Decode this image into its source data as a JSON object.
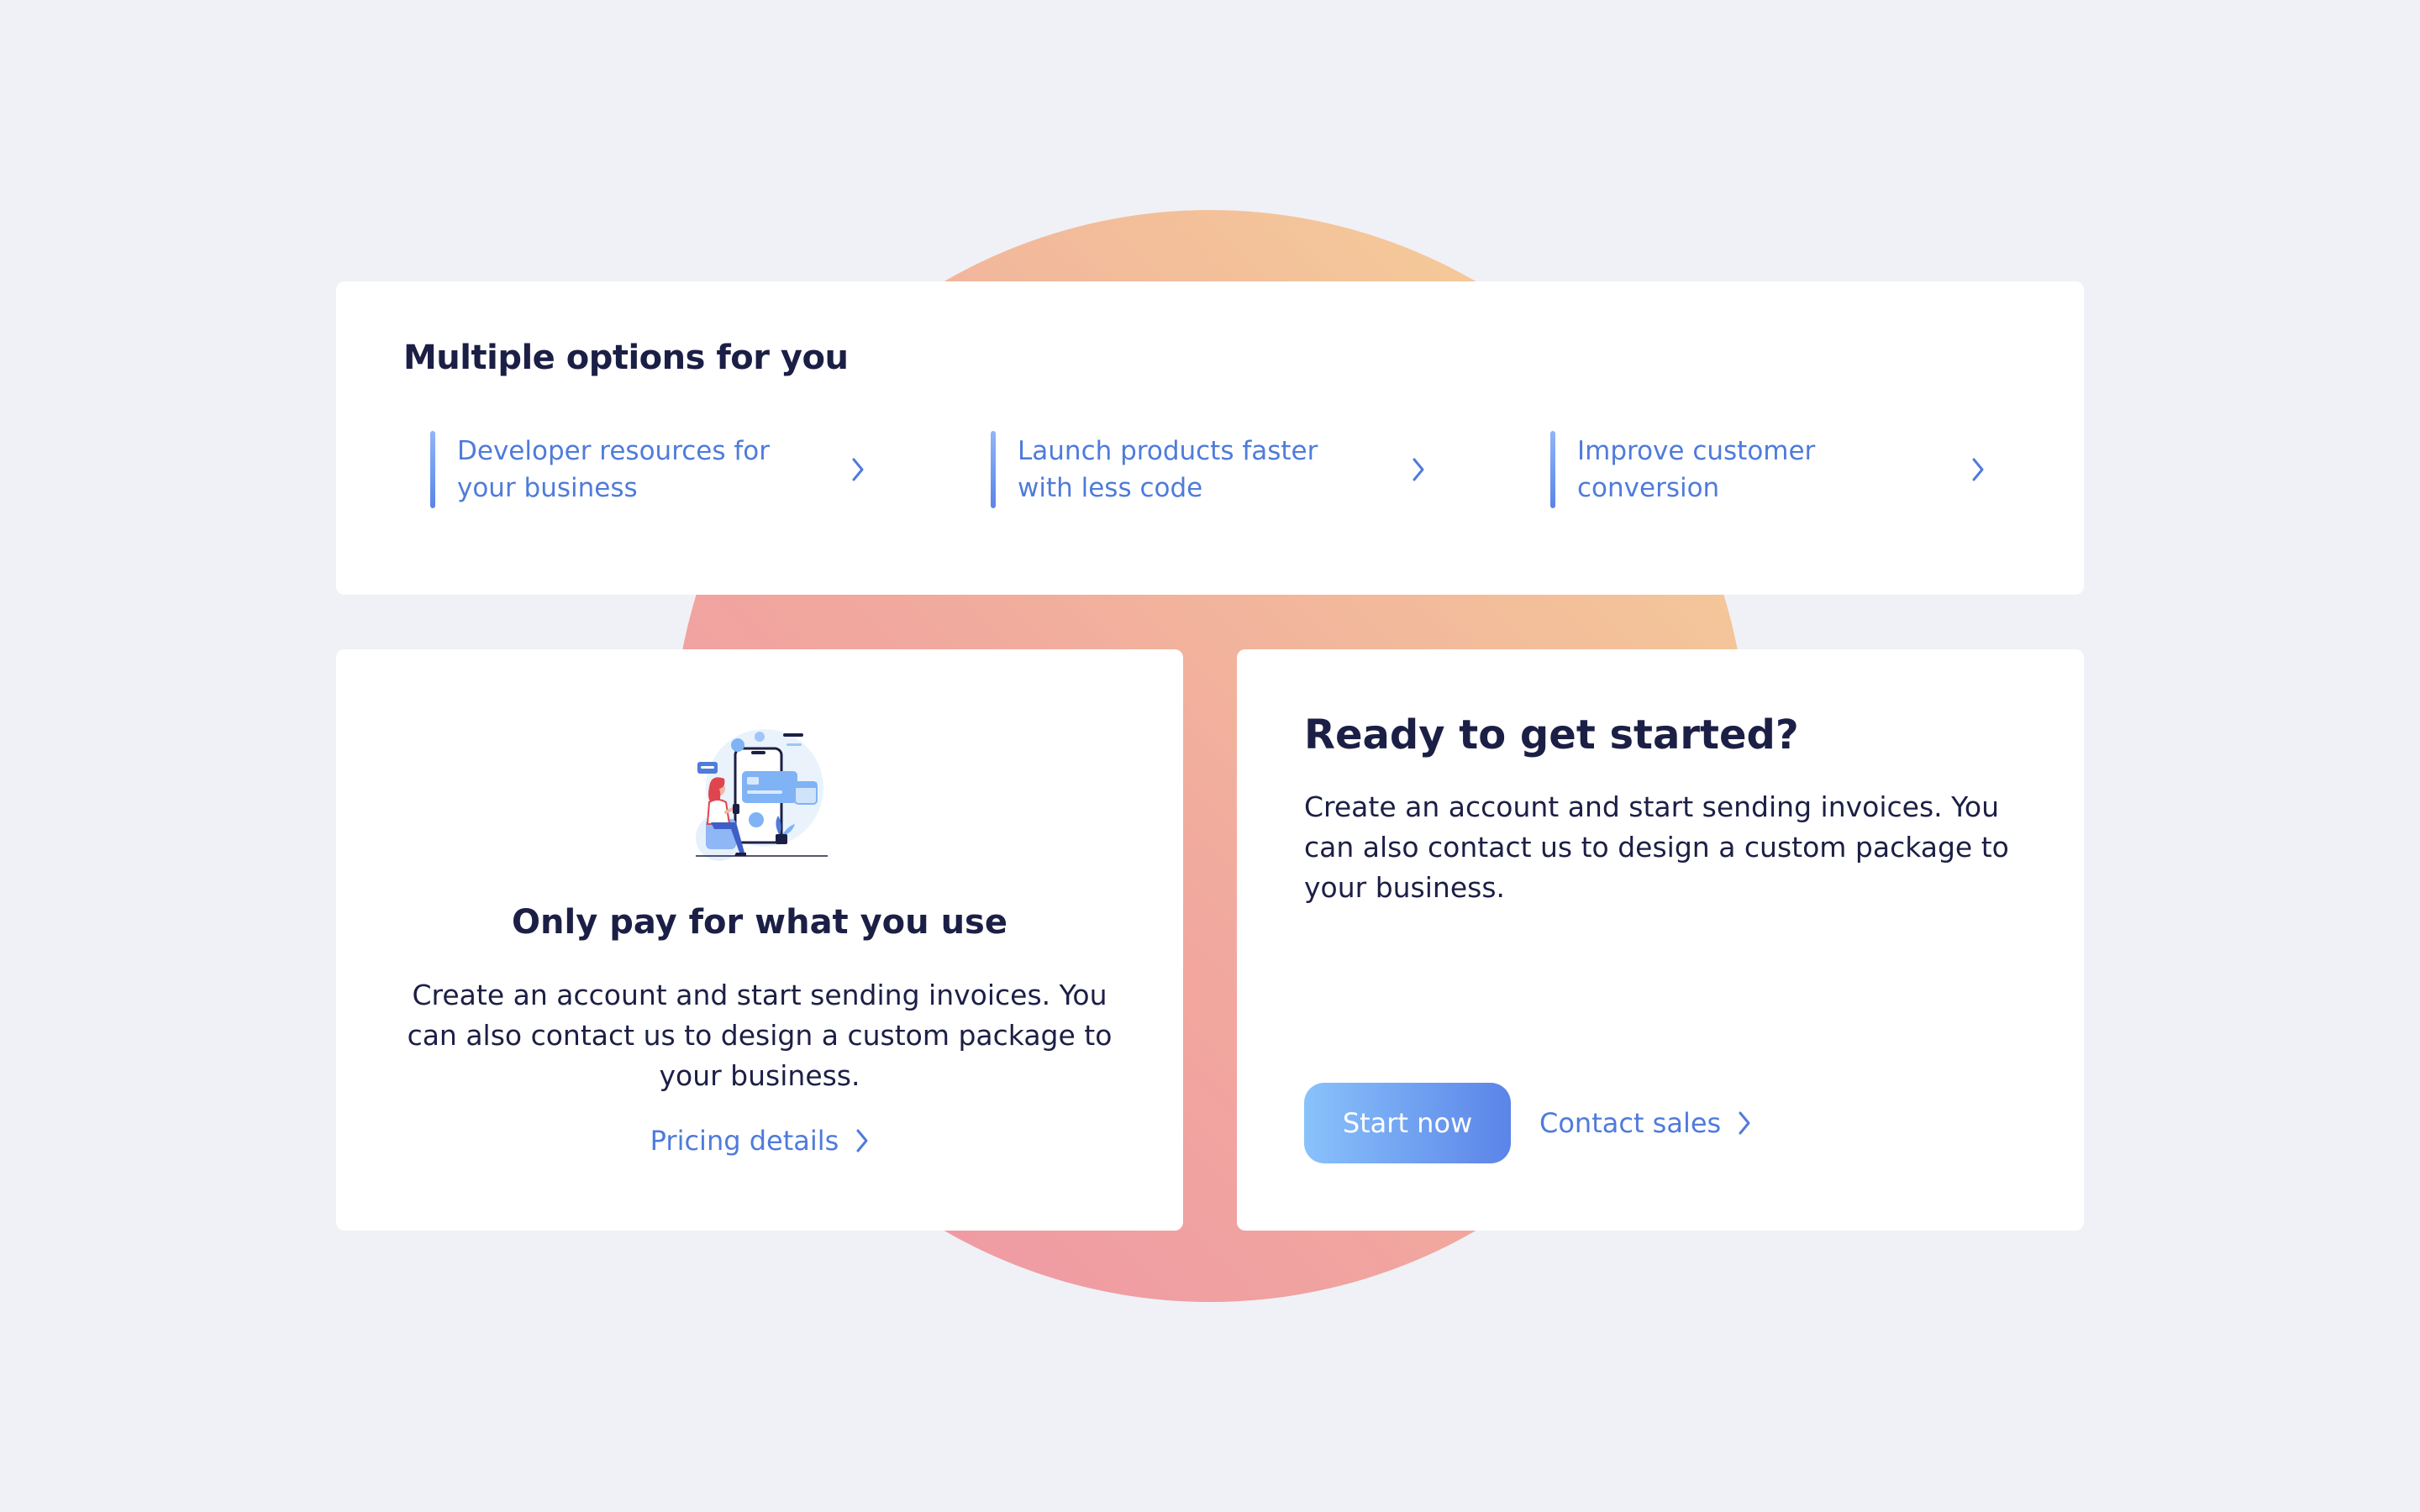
{
  "options_card": {
    "title": "Multiple options for you",
    "items": [
      {
        "label": "Developer resources for your business"
      },
      {
        "label": "Launch products faster with less code"
      },
      {
        "label": "Improve customer conversion"
      }
    ]
  },
  "pricing_card": {
    "title": "Only pay for what you use",
    "description": "Create an account and start sending invoices. You can also contact us to design a custom package to your business.",
    "link_label": "Pricing details"
  },
  "start_card": {
    "title": "Ready to get started?",
    "description": "Create an account and start sending invoices. You can also contact us to design a custom package to your business.",
    "primary_button": "Start now",
    "secondary_link": "Contact sales"
  },
  "colors": {
    "page_background": "#f0f1f6",
    "card_background": "#ffffff",
    "heading": "#1c1f45",
    "link": "#4f7bdb",
    "button_gradient_start": "#89c2fb",
    "button_gradient_end": "#5b84e8",
    "blob_gradient_start": "#ef93a7",
    "blob_gradient_end": "#f6d597"
  },
  "icons": {
    "option_chevron": "chevron-right-icon",
    "link_chevron": "chevron-right-icon",
    "illustration": "mobile-payment-illustration"
  }
}
